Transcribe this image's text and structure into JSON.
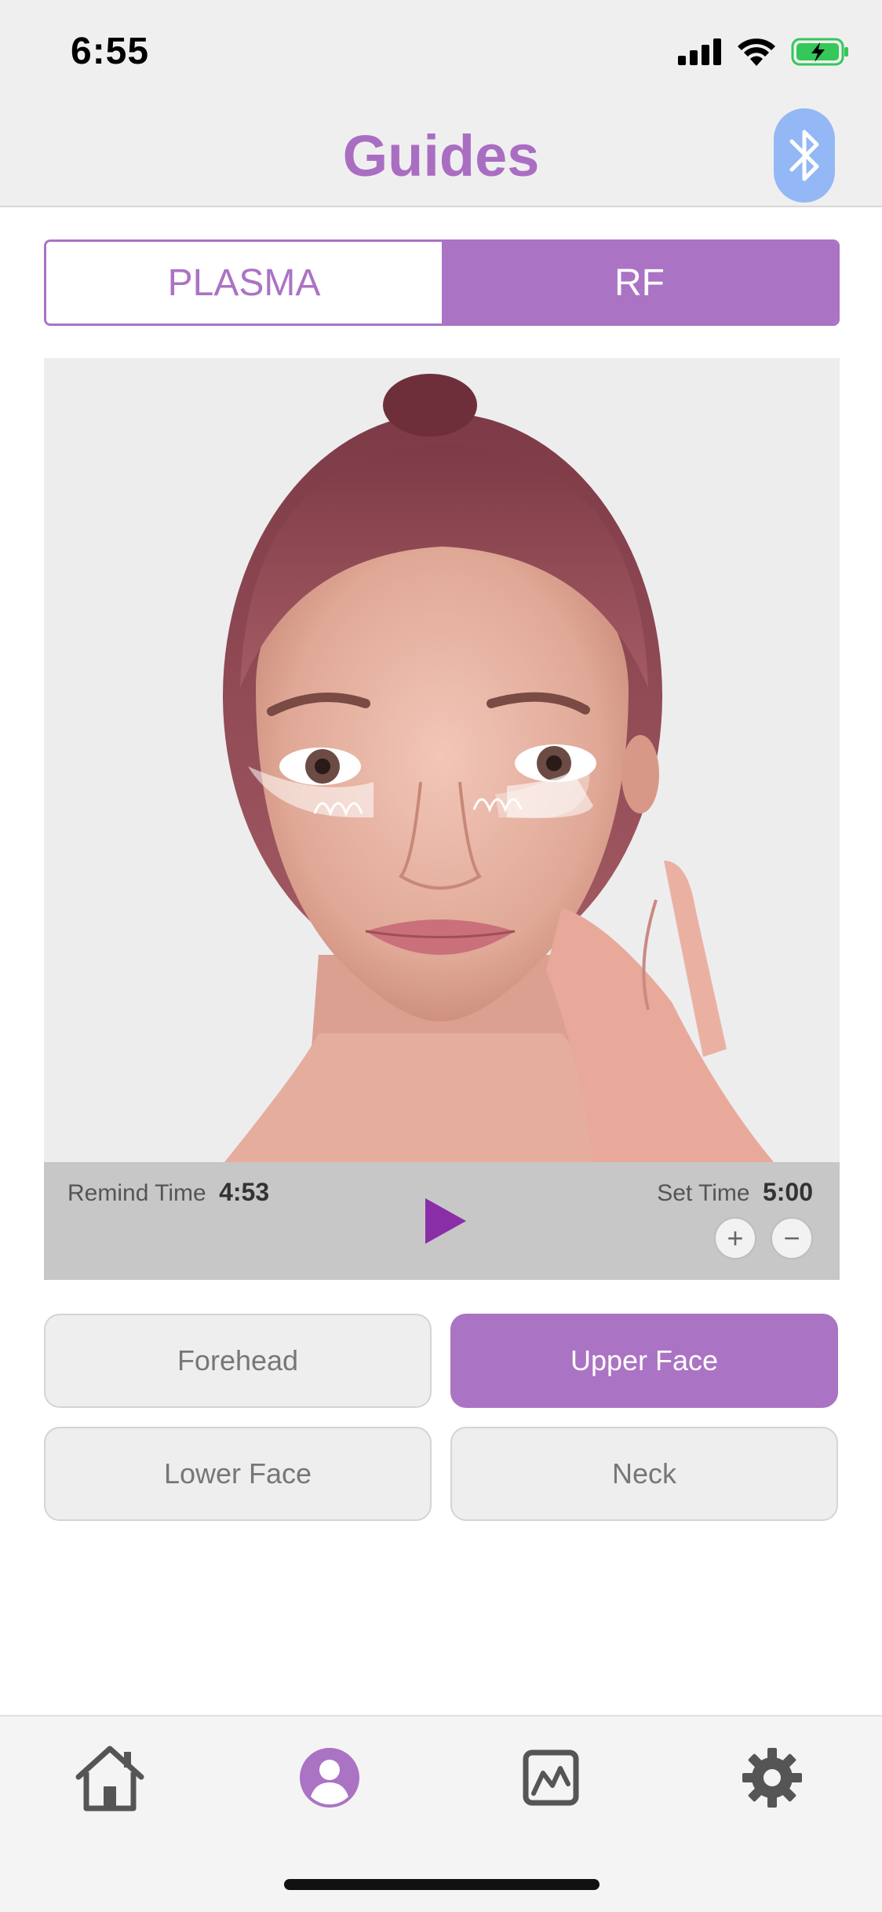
{
  "status_bar": {
    "time": "6:55"
  },
  "header": {
    "title": "Guides",
    "bluetooth_icon": "bluetooth-icon"
  },
  "mode_tabs": [
    {
      "label": "PLASMA",
      "selected": false
    },
    {
      "label": "RF",
      "selected": true
    }
  ],
  "timer": {
    "remind_label": "Remind Time",
    "remind_value": "4:53",
    "set_label": "Set Time",
    "set_value": "5:00",
    "plus": "+",
    "minus": "−"
  },
  "areas": [
    {
      "label": "Forehead",
      "selected": false
    },
    {
      "label": "Upper Face",
      "selected": true
    },
    {
      "label": "Lower Face",
      "selected": false
    },
    {
      "label": "Neck",
      "selected": false
    }
  ],
  "tab_bar": {
    "items": [
      {
        "icon": "home-icon",
        "active": false
      },
      {
        "icon": "profile-icon",
        "active": true
      },
      {
        "icon": "chart-icon",
        "active": false
      },
      {
        "icon": "gear-icon",
        "active": false
      }
    ]
  },
  "colors": {
    "accent": "#ab73c4",
    "bluetooth": "#93b8f5",
    "battery": "#34c759"
  }
}
